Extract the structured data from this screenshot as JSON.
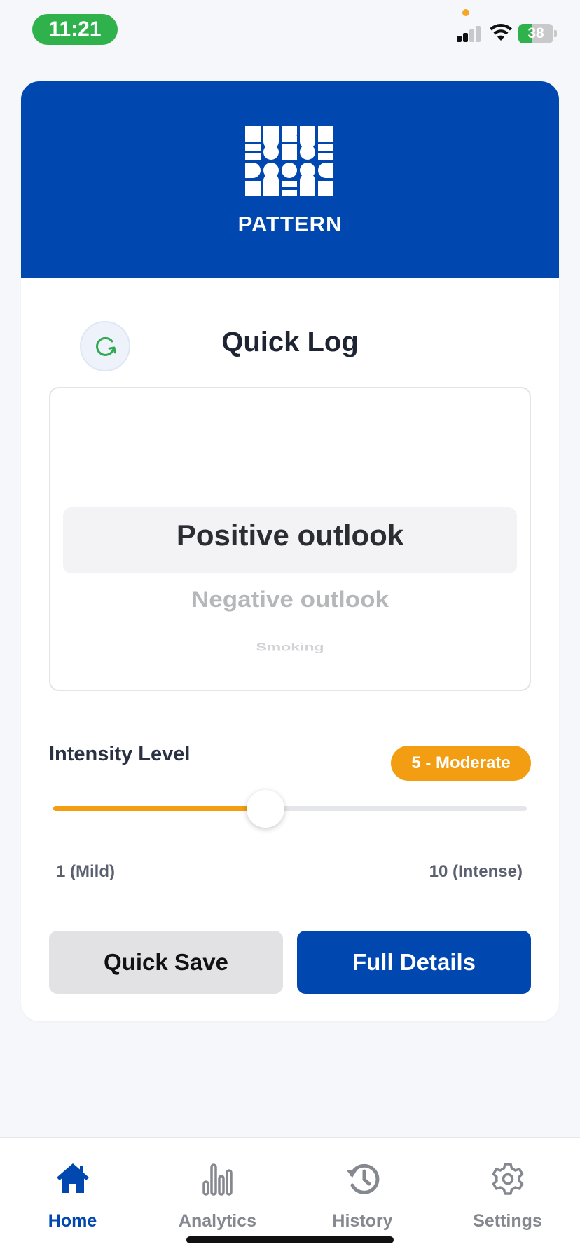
{
  "status_bar": {
    "time": "11:21",
    "battery": "38"
  },
  "header": {
    "brand": "PATTERN",
    "brand_color": "#0048b0"
  },
  "quick_log": {
    "title": "Quick Log",
    "refresh_icon": "refresh-icon",
    "picker": {
      "items": [
        "Positive outlook",
        "Negative outlook",
        "Smoking"
      ],
      "selected": "Positive outlook"
    }
  },
  "intensity": {
    "label": "Intensity Level",
    "badge": "5 - Moderate",
    "value": 5,
    "min": 1,
    "max": 10,
    "min_label": "1 (Mild)",
    "max_label": "10 (Intense)",
    "accent": "#f29d12"
  },
  "actions": {
    "quick_save": "Quick Save",
    "full_details": "Full Details"
  },
  "tabbar": {
    "tabs": [
      {
        "label": "Home",
        "icon": "home-icon",
        "active": true
      },
      {
        "label": "Analytics",
        "icon": "bar-chart-icon",
        "active": false
      },
      {
        "label": "History",
        "icon": "history-icon",
        "active": false
      },
      {
        "label": "Settings",
        "icon": "gear-icon",
        "active": false
      }
    ]
  }
}
